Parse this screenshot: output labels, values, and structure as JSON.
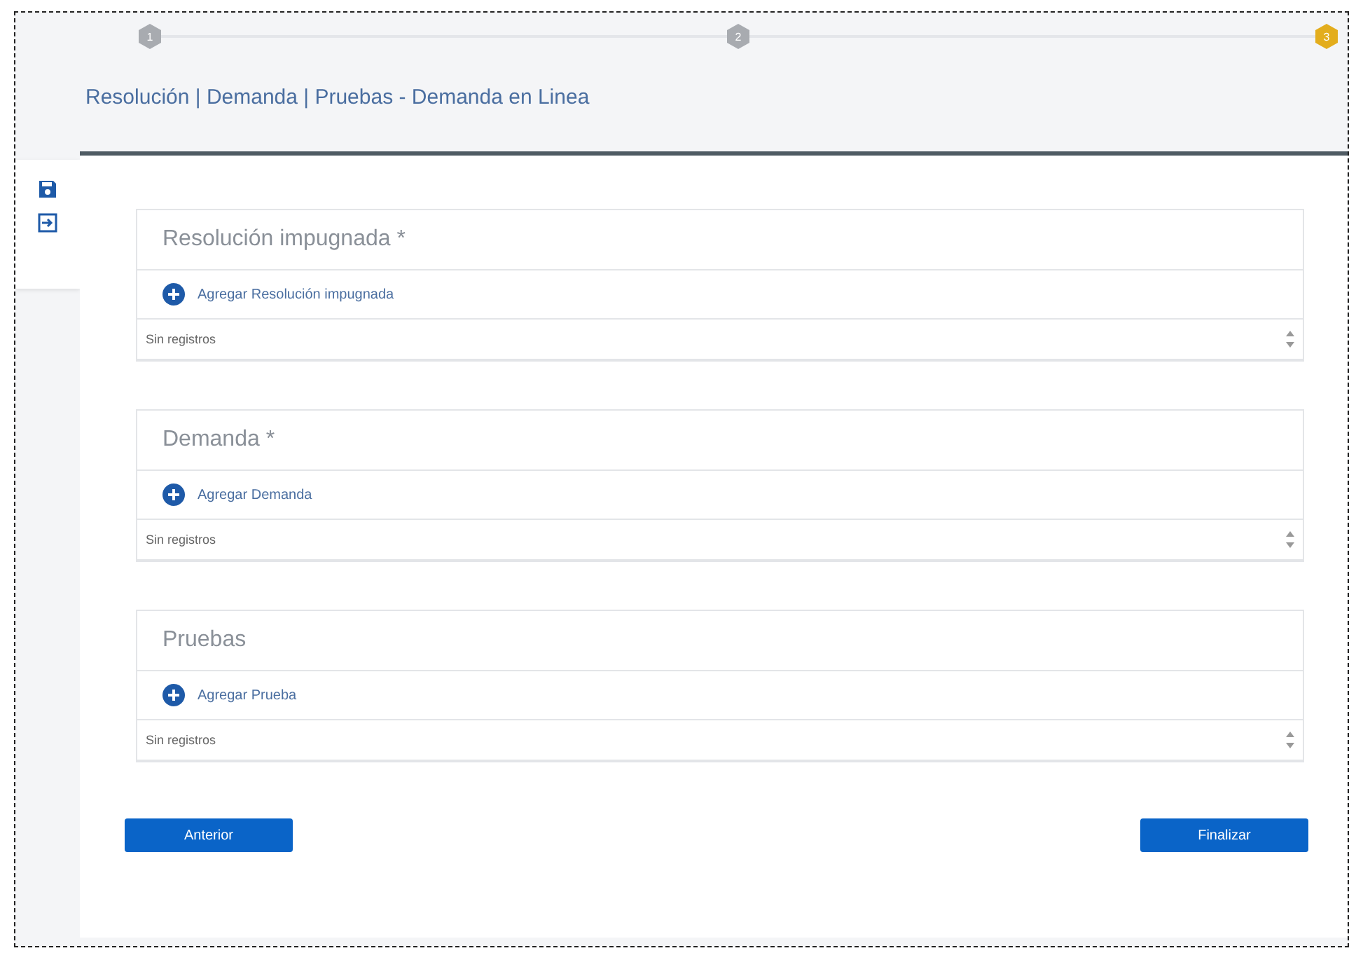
{
  "stepper": {
    "steps": [
      {
        "label": "1",
        "selected": false
      },
      {
        "label": "2",
        "selected": false
      },
      {
        "label": "3",
        "selected": true
      }
    ]
  },
  "title": "Resolución | Demanda | Pruebas - Demanda en Linea",
  "sections": [
    {
      "title": "Resolución impugnada *",
      "add_label": "Agregar Resolución impugnada",
      "value": "Sin registros"
    },
    {
      "title": "Demanda *",
      "add_label": "Agregar Demanda",
      "value": "Sin registros"
    },
    {
      "title": "Pruebas",
      "add_label": "Agregar Prueba",
      "value": "Sin registros"
    }
  ],
  "buttons": {
    "back": "Anterior",
    "finish": "Finalizar"
  }
}
